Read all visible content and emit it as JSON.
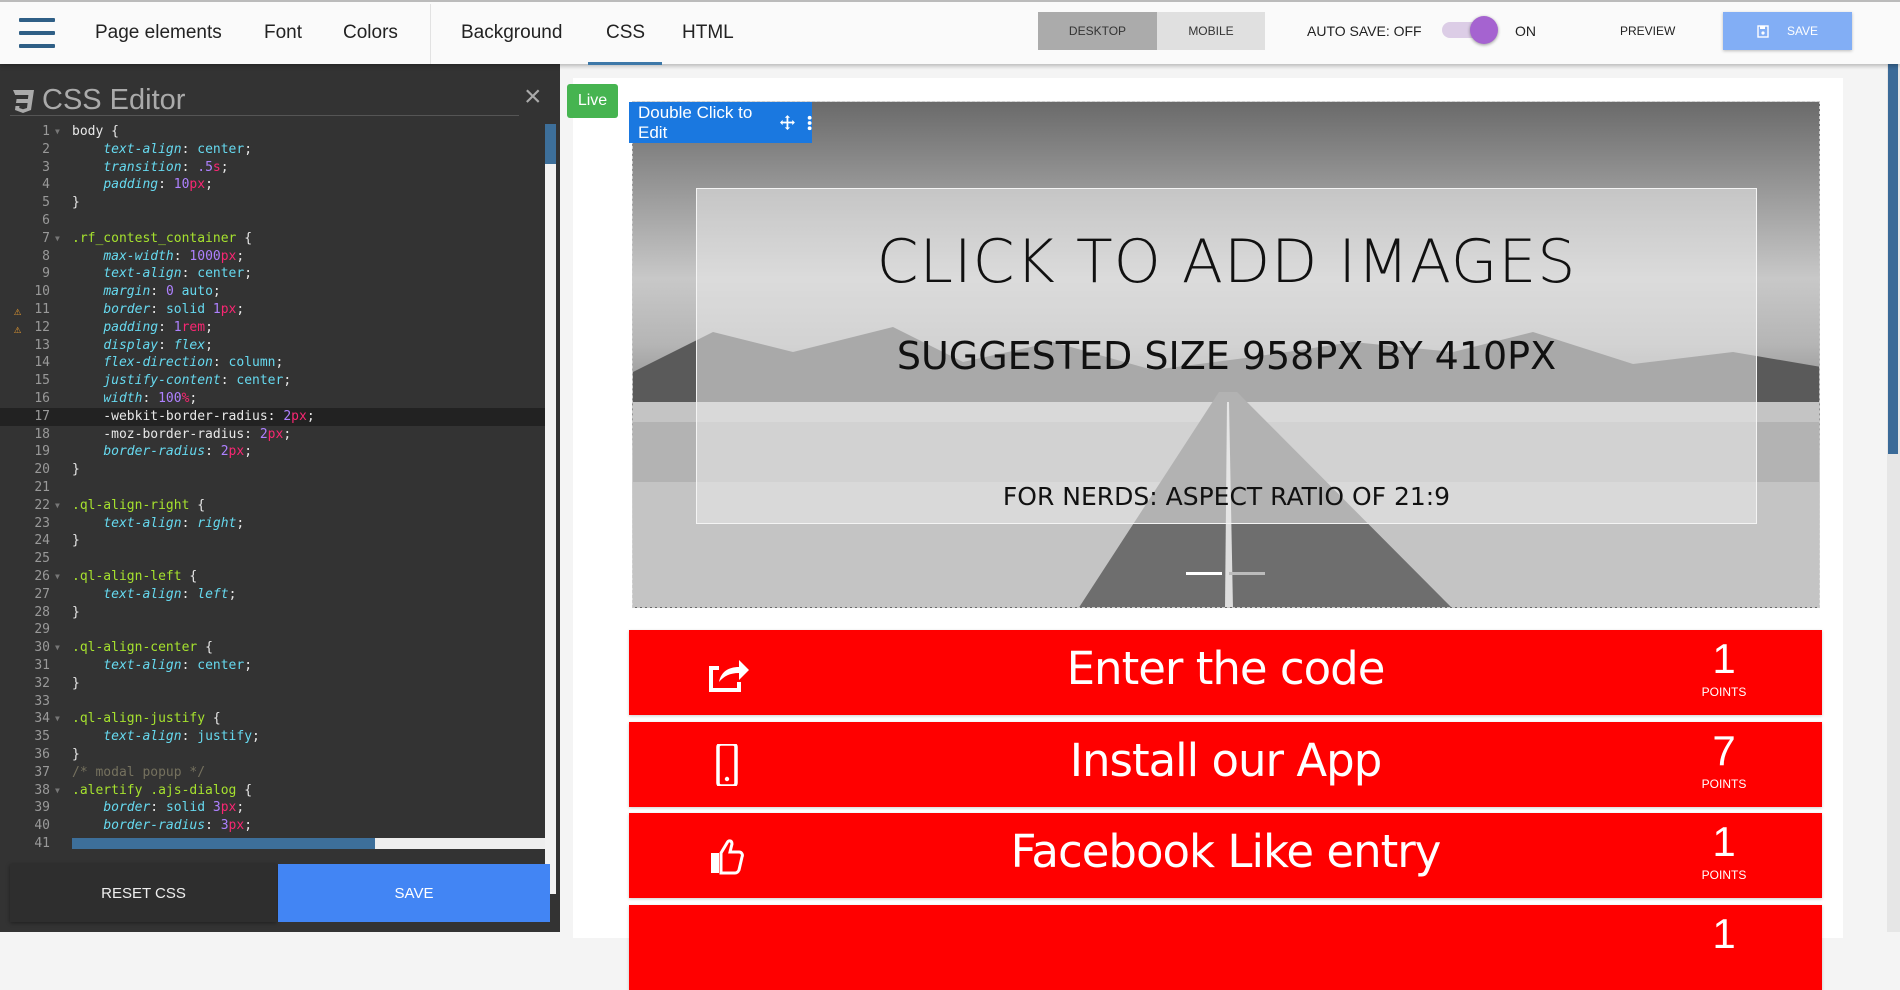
{
  "header": {
    "menu_icon": "hamburger-icon",
    "nav": [
      "Page elements",
      "Font",
      "Colors"
    ],
    "tabs": [
      "Background",
      "CSS",
      "HTML"
    ],
    "active_tab": "CSS",
    "view_toggle": {
      "desktop": "DESKTOP",
      "mobile": "MOBILE",
      "selected": "DESKTOP"
    },
    "auto_save_label": "AUTO SAVE: OFF",
    "auto_save_on_label": "ON",
    "auto_save_enabled": true,
    "preview": "PREVIEW",
    "save": "SAVE",
    "save_icon": "floppy-disk-icon",
    "accent": "#a563d0"
  },
  "editor": {
    "title": "CSS Editor",
    "close": "×",
    "reset": "RESET CSS",
    "save": "SAVE",
    "active_line": 17,
    "lines": [
      [
        [
          "body ",
          "punc"
        ],
        [
          "{",
          "punc"
        ]
      ],
      [
        [
          "    ",
          "punc"
        ],
        [
          "text-align",
          "prop"
        ],
        [
          ": ",
          "punc"
        ],
        [
          "center",
          "val"
        ],
        [
          ";",
          "punc"
        ]
      ],
      [
        [
          "    ",
          "punc"
        ],
        [
          "transition",
          "prop"
        ],
        [
          ": ",
          "punc"
        ],
        [
          ".5",
          "num"
        ],
        [
          "s",
          "unit"
        ],
        [
          ";",
          "punc"
        ]
      ],
      [
        [
          "    ",
          "punc"
        ],
        [
          "padding",
          "prop"
        ],
        [
          ": ",
          "punc"
        ],
        [
          "10",
          "num"
        ],
        [
          "px",
          "unit"
        ],
        [
          ";",
          "punc"
        ]
      ],
      [
        [
          "}",
          "punc"
        ]
      ],
      [],
      [
        [
          ".rf_contest_container ",
          "sel"
        ],
        [
          "{",
          "punc"
        ]
      ],
      [
        [
          "    ",
          "punc"
        ],
        [
          "max-width",
          "prop"
        ],
        [
          ": ",
          "punc"
        ],
        [
          "1000",
          "num"
        ],
        [
          "px",
          "unit"
        ],
        [
          ";",
          "punc"
        ]
      ],
      [
        [
          "    ",
          "punc"
        ],
        [
          "text-align",
          "prop"
        ],
        [
          ": ",
          "punc"
        ],
        [
          "center",
          "val"
        ],
        [
          ";",
          "punc"
        ]
      ],
      [
        [
          "    ",
          "punc"
        ],
        [
          "margin",
          "prop"
        ],
        [
          ": ",
          "punc"
        ],
        [
          "0",
          "num"
        ],
        [
          " auto",
          "val"
        ],
        [
          ";",
          "punc"
        ]
      ],
      [
        [
          "    ",
          "punc"
        ],
        [
          "border",
          "prop"
        ],
        [
          ": ",
          "punc"
        ],
        [
          "solid ",
          "val"
        ],
        [
          "1",
          "num"
        ],
        [
          "px",
          "unit"
        ],
        [
          ";",
          "punc"
        ]
      ],
      [
        [
          "    ",
          "punc"
        ],
        [
          "padding",
          "prop"
        ],
        [
          ": ",
          "punc"
        ],
        [
          "1",
          "num"
        ],
        [
          "rem",
          "unit"
        ],
        [
          ";",
          "punc"
        ]
      ],
      [
        [
          "    ",
          "punc"
        ],
        [
          "display",
          "prop"
        ],
        [
          ": ",
          "punc"
        ],
        [
          "flex",
          "it"
        ],
        [
          ";",
          "punc"
        ]
      ],
      [
        [
          "    ",
          "punc"
        ],
        [
          "flex-direction",
          "prop"
        ],
        [
          ": ",
          "punc"
        ],
        [
          "column",
          "val"
        ],
        [
          ";",
          "punc"
        ]
      ],
      [
        [
          "    ",
          "punc"
        ],
        [
          "justify-content",
          "prop"
        ],
        [
          ": ",
          "punc"
        ],
        [
          "center",
          "val"
        ],
        [
          ";",
          "punc"
        ]
      ],
      [
        [
          "    ",
          "punc"
        ],
        [
          "width",
          "prop"
        ],
        [
          ": ",
          "punc"
        ],
        [
          "100",
          "num"
        ],
        [
          "%",
          "unit"
        ],
        [
          ";",
          "punc"
        ]
      ],
      [
        [
          "    -webkit-border-radius: ",
          "punc"
        ],
        [
          "2",
          "num"
        ],
        [
          "px",
          "unit"
        ],
        [
          ";",
          "punc"
        ]
      ],
      [
        [
          "    -moz-border-radius: ",
          "punc"
        ],
        [
          "2",
          "num"
        ],
        [
          "px",
          "unit"
        ],
        [
          ";",
          "punc"
        ]
      ],
      [
        [
          "    ",
          "punc"
        ],
        [
          "border-radius",
          "prop"
        ],
        [
          ": ",
          "punc"
        ],
        [
          "2",
          "num"
        ],
        [
          "px",
          "unit"
        ],
        [
          ";",
          "punc"
        ]
      ],
      [
        [
          "}",
          "punc"
        ]
      ],
      [],
      [
        [
          ".ql-align-right ",
          "sel"
        ],
        [
          "{",
          "punc"
        ]
      ],
      [
        [
          "    ",
          "punc"
        ],
        [
          "text-align",
          "prop"
        ],
        [
          ": ",
          "punc"
        ],
        [
          "right",
          "it"
        ],
        [
          ";",
          "punc"
        ]
      ],
      [
        [
          "}",
          "punc"
        ]
      ],
      [],
      [
        [
          ".ql-align-left ",
          "sel"
        ],
        [
          "{",
          "punc"
        ]
      ],
      [
        [
          "    ",
          "punc"
        ],
        [
          "text-align",
          "prop"
        ],
        [
          ": ",
          "punc"
        ],
        [
          "left",
          "it"
        ],
        [
          ";",
          "punc"
        ]
      ],
      [
        [
          "}",
          "punc"
        ]
      ],
      [],
      [
        [
          ".ql-align-center ",
          "sel"
        ],
        [
          "{",
          "punc"
        ]
      ],
      [
        [
          "    ",
          "punc"
        ],
        [
          "text-align",
          "prop"
        ],
        [
          ": ",
          "punc"
        ],
        [
          "center",
          "val"
        ],
        [
          ";",
          "punc"
        ]
      ],
      [
        [
          "}",
          "punc"
        ]
      ],
      [],
      [
        [
          ".ql-align-justify ",
          "sel"
        ],
        [
          "{",
          "punc"
        ]
      ],
      [
        [
          "    ",
          "punc"
        ],
        [
          "text-align",
          "prop"
        ],
        [
          ": ",
          "punc"
        ],
        [
          "justify",
          "val"
        ],
        [
          ";",
          "punc"
        ]
      ],
      [
        [
          "}",
          "punc"
        ]
      ],
      [
        [
          "/* modal popup */",
          "com"
        ]
      ],
      [
        [
          ".alertify .ajs-dialog ",
          "sel"
        ],
        [
          "{",
          "punc"
        ]
      ],
      [
        [
          "    ",
          "punc"
        ],
        [
          "border",
          "prop"
        ],
        [
          ": ",
          "punc"
        ],
        [
          "solid ",
          "val"
        ],
        [
          "3",
          "num"
        ],
        [
          "px",
          "unit"
        ],
        [
          ";",
          "punc"
        ]
      ],
      [
        [
          "    ",
          "punc"
        ],
        [
          "border-radius",
          "prop"
        ],
        [
          ": ",
          "punc"
        ],
        [
          "3",
          "num"
        ],
        [
          "px",
          "unit"
        ],
        [
          ";",
          "punc"
        ]
      ],
      []
    ],
    "fold_lines": [
      1,
      7,
      22,
      26,
      30,
      34,
      38
    ],
    "warning_lines": [
      11,
      12
    ]
  },
  "preview": {
    "live_badge": "Live",
    "edit_bar": "Double Click to Edit",
    "edit_icons": [
      "move-icon",
      "more-vertical-icon"
    ],
    "hero": {
      "title": "CLICK TO ADD IMAGES",
      "subtitle": "SUGGESTED SIZE 958PX  BY 410PX",
      "note": "FOR NERDS: ASPECT RATIO OF 21:9"
    },
    "row_color": "#ff0000",
    "entries": [
      {
        "icon": "share-icon",
        "label": "Enter the code",
        "points": "1",
        "points_label": "POINTS"
      },
      {
        "icon": "mobile-phone-icon",
        "label": "Install our App",
        "points": "7",
        "points_label": "POINTS"
      },
      {
        "icon": "thumbs-up-icon",
        "label": "Facebook Like entry",
        "points": "1",
        "points_label": "POINTS"
      },
      {
        "icon": "",
        "label": "",
        "points": "1",
        "points_label": ""
      }
    ]
  }
}
